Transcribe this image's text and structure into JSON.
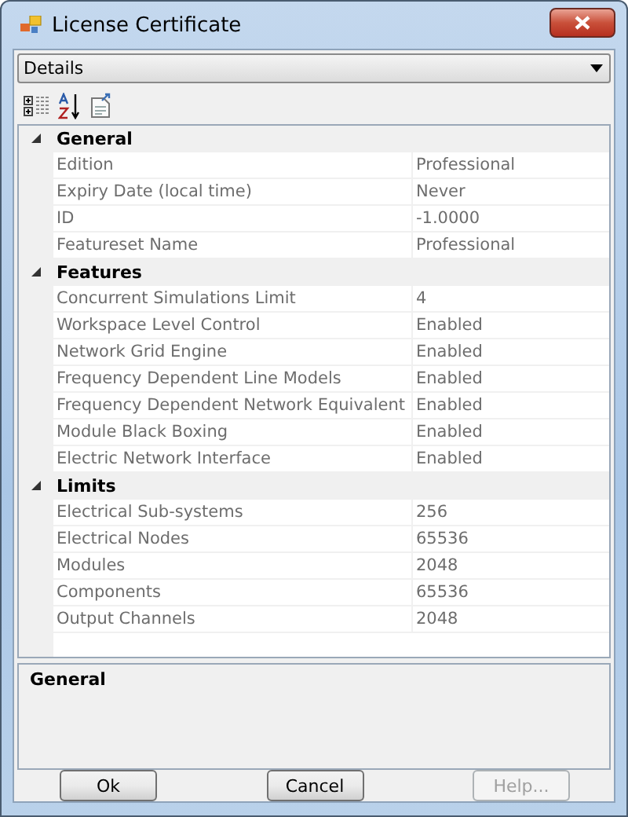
{
  "window": {
    "title": "License Certificate"
  },
  "view_selector": {
    "value": "Details"
  },
  "categories": [
    {
      "name": "General",
      "expanded": true,
      "properties": [
        {
          "name": "Edition",
          "value": "Professional"
        },
        {
          "name": "Expiry Date (local time)",
          "value": "Never"
        },
        {
          "name": "ID",
          "value": "-1.0000"
        },
        {
          "name": "Featureset Name",
          "value": "Professional"
        }
      ]
    },
    {
      "name": "Features",
      "expanded": true,
      "properties": [
        {
          "name": "Concurrent Simulations Limit",
          "value": "4"
        },
        {
          "name": "Workspace Level Control",
          "value": "Enabled"
        },
        {
          "name": "Network Grid Engine",
          "value": "Enabled"
        },
        {
          "name": "Frequency Dependent Line Models",
          "value": "Enabled"
        },
        {
          "name": "Frequency Dependent Network Equivalent",
          "value": "Enabled"
        },
        {
          "name": "Module Black Boxing",
          "value": "Enabled"
        },
        {
          "name": "Electric Network Interface",
          "value": "Enabled"
        }
      ]
    },
    {
      "name": "Limits",
      "expanded": true,
      "properties": [
        {
          "name": "Electrical Sub-systems",
          "value": "256"
        },
        {
          "name": "Electrical Nodes",
          "value": "65536"
        },
        {
          "name": "Modules",
          "value": "2048"
        },
        {
          "name": "Components",
          "value": "65536"
        },
        {
          "name": "Output Channels",
          "value": "2048"
        }
      ]
    }
  ],
  "description": {
    "title": "General"
  },
  "buttons": [
    {
      "label": "Ok",
      "disabled": false
    },
    {
      "label": "Cancel",
      "disabled": false
    },
    {
      "label": "Help...",
      "disabled": true
    }
  ]
}
